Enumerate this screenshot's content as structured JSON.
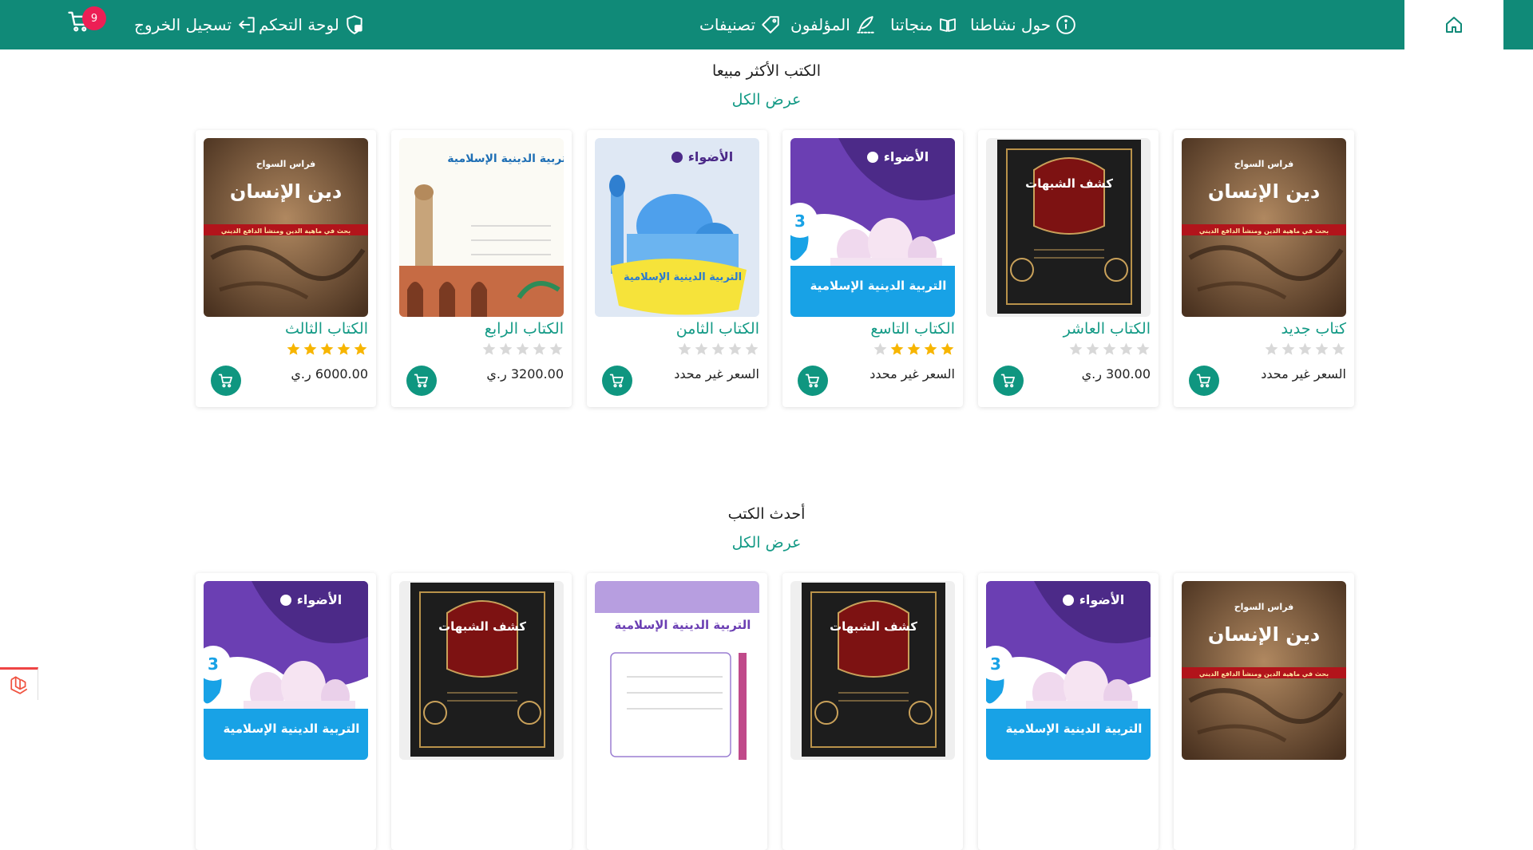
{
  "nav": {
    "about": "حول نشاطنا",
    "products": "منجاتنا",
    "authors": "المؤلفون",
    "categories": "تصنيفات",
    "dashboard": "لوحة التحكم",
    "logout": "تسجيل الخروج",
    "cart_count": "9"
  },
  "colors": {
    "brand": "#108a78",
    "accent": "#149a86",
    "badge": "#ec1f55",
    "star_on": "#f7b500",
    "star_off": "#d8d8d8"
  },
  "icons": [
    "home-icon",
    "info-icon",
    "book-open-icon",
    "quill-icon",
    "tag-icon",
    "user-lock-icon",
    "logout-icon",
    "cart-icon",
    "star-icon"
  ],
  "best_sellers": {
    "title": "الكتب الأكثر مبيعا",
    "view_all": "عرض الكل",
    "books": [
      {
        "title": "كتاب جديد",
        "rating": 0,
        "price": "السعر غير محدد"
      },
      {
        "title": "الكتاب العاشر",
        "rating": 0,
        "price": "300.00 ر.ي"
      },
      {
        "title": "الكتاب التاسع",
        "rating": 4,
        "price": "السعر غير محدد"
      },
      {
        "title": "الكتاب الثامن",
        "rating": 0,
        "price": "السعر غير محدد"
      },
      {
        "title": "الكتاب الرابع",
        "rating": 0,
        "price": "3200.00 ر.ي"
      },
      {
        "title": "الكتاب الثالث",
        "rating": 5,
        "price": "6000.00 ر.ي"
      }
    ]
  },
  "newest": {
    "title": "أحدث الكتب",
    "view_all": "عرض الكل"
  },
  "covers": {
    "dark_title": "دين الإنسان",
    "dark_author": "فراس السواح",
    "dark_subtitle": "بحث في ماهية الدين ومنشأ الدافع الديني",
    "green_title": "كشف الشبهات",
    "purple_brand": "الأضواء",
    "purple_grade": "3",
    "purple_title": "التربية الدينية الإسلامية",
    "white_title": "التربية الدينية الإسلامية"
  }
}
